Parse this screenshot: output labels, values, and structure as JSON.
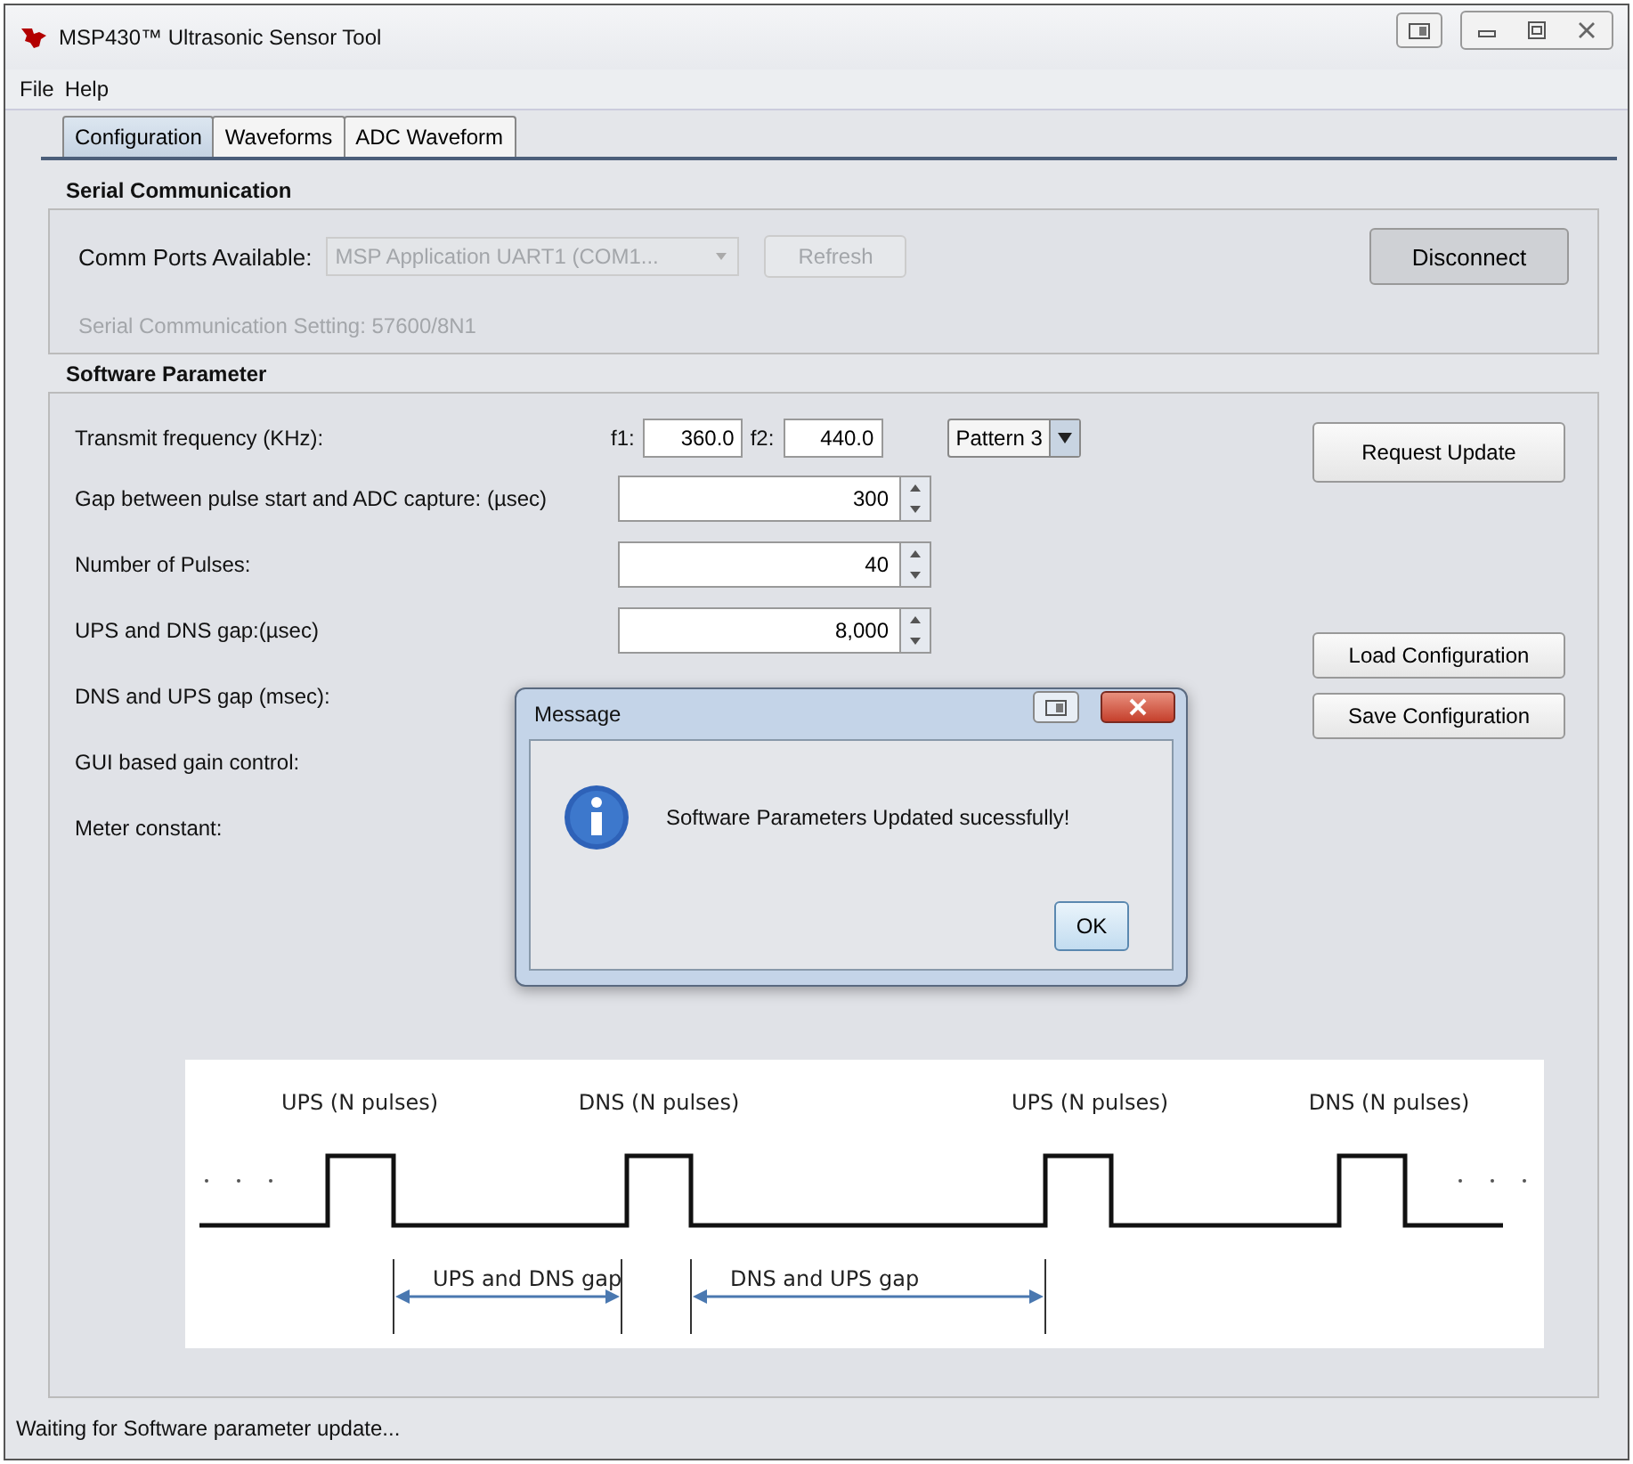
{
  "window": {
    "title": "MSP430™ Ultrasonic Sensor Tool"
  },
  "menu": [
    "File",
    "Help"
  ],
  "tabs": [
    {
      "label": "Configuration",
      "selected": true
    },
    {
      "label": "Waveforms",
      "selected": false
    },
    {
      "label": "ADC Waveform",
      "selected": false
    }
  ],
  "serial": {
    "title": "Serial Communication",
    "ports_label": "Comm Ports Available:",
    "port_value": "MSP Application UART1 (COM1...",
    "ports_disabled": true,
    "refresh": "Refresh",
    "refresh_disabled": true,
    "disconnect": "Disconnect",
    "setting": "Serial Communication Setting: 57600/8N1"
  },
  "software": {
    "title": "Software Parameter",
    "frequency": {
      "label": "Transmit frequency (KHz):",
      "f1_label": "f1:",
      "f1": "360.0",
      "f2_label": "f2:",
      "f2": "440.0",
      "pattern": "Pattern 3"
    },
    "rows": [
      {
        "kind": "spinner",
        "label": "Gap between pulse start and ADC capture: (µsec)",
        "value": "300"
      },
      {
        "kind": "spinner",
        "label": "Number of Pulses:",
        "value": "40"
      },
      {
        "kind": "spinner",
        "label": "UPS and DNS gap:(µsec)",
        "value": "8,000"
      },
      {
        "kind": "label",
        "label": "DNS and UPS gap (msec):"
      },
      {
        "kind": "label",
        "label": "GUI based gain control:"
      },
      {
        "kind": "label",
        "label": "Meter constant:"
      }
    ],
    "buttons": [
      "Request Update",
      "Load Configuration",
      "Save Configuration"
    ]
  },
  "diagram": {
    "pulse_labels": [
      "UPS (N pulses)",
      "DNS (N pulses)",
      "UPS (N pulses)",
      "DNS (N pulses)"
    ],
    "gap_labels": [
      "UPS and DNS gap",
      "DNS and UPS gap"
    ]
  },
  "dialog": {
    "title": "Message",
    "message": "Software Parameters Updated sucessfully!",
    "ok": "OK"
  },
  "status_bar": "Waiting for Software parameter update..."
}
